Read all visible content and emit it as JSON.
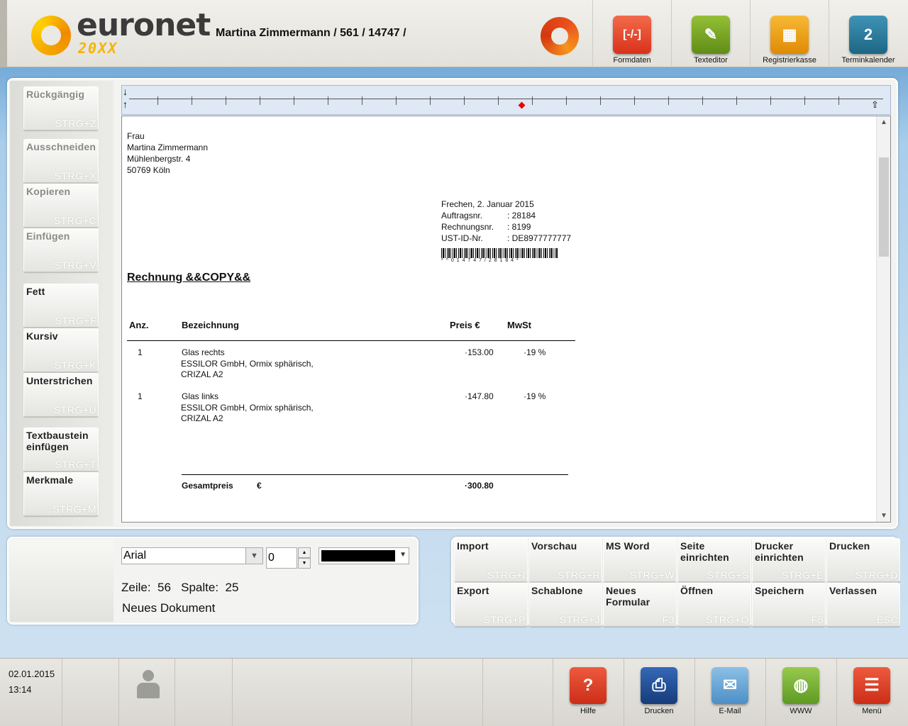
{
  "header": {
    "logo_text": "euronet",
    "logo_sub": "20XX",
    "patient": "Martina Zimmermann / 561 / 14747 /",
    "buttons": [
      {
        "label": "Formdaten",
        "icon": "formdaten-icon",
        "color": "#e8452c"
      },
      {
        "label": "Texteditor",
        "icon": "pencil-icon",
        "color": "#7aa524"
      },
      {
        "label": "Registrierkasse",
        "icon": "cash-register-icon",
        "color": "#f0a312"
      },
      {
        "label": "Terminkalender",
        "icon": "calendar-icon",
        "color": "#2e7ea0"
      }
    ],
    "calendar_day": "2"
  },
  "left_buttons": {
    "undo": {
      "label": "Rückgängig",
      "key": "STRG+Z"
    },
    "cut": {
      "label": "Ausschneiden",
      "key": "STRG+X"
    },
    "copy": {
      "label": "Kopieren",
      "key": "STRG+C"
    },
    "paste": {
      "label": "Einfügen",
      "key": "STRG+V"
    },
    "bold": {
      "label": "Fett",
      "key": "STRG+F"
    },
    "italic": {
      "label": "Kursiv",
      "key": "STRG+K"
    },
    "underline": {
      "label": "Unterstrichen",
      "key": "STRG+U"
    },
    "textblock": {
      "label": "Textbaustein einfügen",
      "key": "STRG+T"
    },
    "features": {
      "label": "Merkmale",
      "key": "STRG+M"
    }
  },
  "document": {
    "address": [
      "Frau",
      "Martina Zimmermann",
      "Mühlenbergstr. 4",
      "50769 Köln"
    ],
    "place_date": "Frechen, 2. Januar 2015",
    "order_label": "Auftragsnr.",
    "order_value": ": 28184",
    "invoice_label": "Rechnungsnr.",
    "invoice_value": ": 8199",
    "vat_label": "UST-ID-Nr.",
    "vat_value": ": DE8977777777",
    "barcode_text": "* ^ 0 1 4 7 4 7 / 2 8 1 8 4 *",
    "title": "Rechnung &&COPY&&",
    "col_qty": "Anz.",
    "col_desc": "Bezeichnung",
    "col_price": "Preis €",
    "col_vat": "MwSt",
    "items": [
      {
        "qty": "1",
        "name": "Glas rechts",
        "line2": "ESSILOR GmbH, Ormix sphärisch,",
        "line3": "CRIZAL A2",
        "price": "·153.00",
        "vat": "·19 %"
      },
      {
        "qty": "1",
        "name": "Glas links",
        "line2": "ESSILOR GmbH, Ormix sphärisch,",
        "line3": "CRIZAL A2",
        "price": "·147.80",
        "vat": "·19 %"
      }
    ],
    "total_label": "Gesamtpreis",
    "total_currency": "€",
    "total_value": "·300.80"
  },
  "format_bar": {
    "font": "Arial",
    "size": "0",
    "color": "#000000",
    "line_label": "Zeile:",
    "line_value": "56",
    "col_label": "Spalte:",
    "col_value": "25",
    "doc_status": "Neues Dokument"
  },
  "action_buttons": [
    {
      "label": "Import",
      "key": "STRG+I"
    },
    {
      "label": "Vorschau",
      "key": "STRG+R"
    },
    {
      "label": "MS Word",
      "key": "STRG+W"
    },
    {
      "label": "Seite einrichten",
      "key": "STRG+S"
    },
    {
      "label": "Drucker einrichten",
      "key": "STRG+E"
    },
    {
      "label": "Drucken",
      "key": "STRG+D"
    },
    {
      "label": "Export",
      "key": "STRG+P"
    },
    {
      "label": "Schablone",
      "key": "STRG+J"
    },
    {
      "label": "Neues Formular",
      "key": "F3"
    },
    {
      "label": "Öffnen",
      "key": "STRG+O"
    },
    {
      "label": "Speichern",
      "key": "F5"
    },
    {
      "label": "Verlassen",
      "key": "ESC"
    }
  ],
  "taskbar": {
    "date": "02.01.2015",
    "time": "13:14",
    "buttons": [
      {
        "label": "Hilfe",
        "icon": "help-icon",
        "color": "#e2412a"
      },
      {
        "label": "Drucken",
        "icon": "printer-icon",
        "color": "#1f4f9a"
      },
      {
        "label": "E-Mail",
        "icon": "mail-icon",
        "color": "#6aa8d8"
      },
      {
        "label": "WWW",
        "icon": "globe-icon",
        "color": "#7fb63a"
      },
      {
        "label": "Menü",
        "icon": "menu-icon",
        "color": "#e2412a"
      }
    ]
  }
}
